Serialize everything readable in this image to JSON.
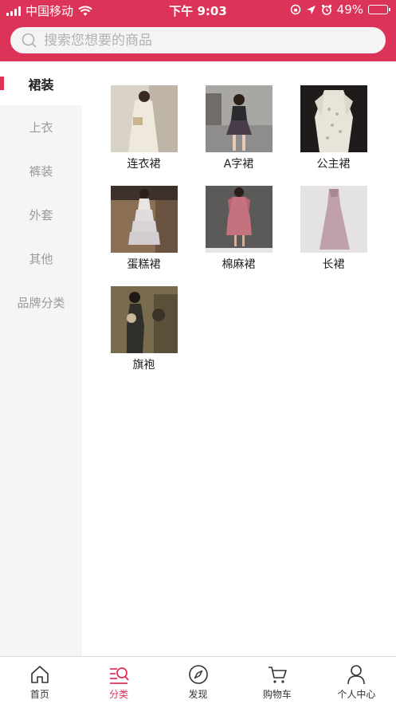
{
  "status": {
    "carrier": "中国移动",
    "time": "下午 9:03",
    "battery": "49%",
    "battery_level": 0.49
  },
  "search": {
    "placeholder": "搜索您想要的商品"
  },
  "sidebar": {
    "items": [
      {
        "label": "裙装",
        "active": true
      },
      {
        "label": "上衣"
      },
      {
        "label": "裤装"
      },
      {
        "label": "外套"
      },
      {
        "label": "其他"
      },
      {
        "label": "品牌分类"
      }
    ]
  },
  "categories": {
    "items": [
      {
        "label": "连衣裙"
      },
      {
        "label": "A字裙"
      },
      {
        "label": "公主裙"
      },
      {
        "label": "蛋糕裙"
      },
      {
        "label": "棉麻裙"
      },
      {
        "label": "长裙"
      },
      {
        "label": "旗袍"
      }
    ]
  },
  "tabbar": {
    "items": [
      {
        "label": "首页",
        "icon": "home-icon"
      },
      {
        "label": "分类",
        "icon": "category-icon",
        "active": true
      },
      {
        "label": "发现",
        "icon": "compass-icon"
      },
      {
        "label": "购物车",
        "icon": "cart-icon"
      },
      {
        "label": "个人中心",
        "icon": "user-icon"
      }
    ]
  },
  "colors": {
    "accent": "#dc3358",
    "sidebar_bg": "#f4f5f5"
  }
}
